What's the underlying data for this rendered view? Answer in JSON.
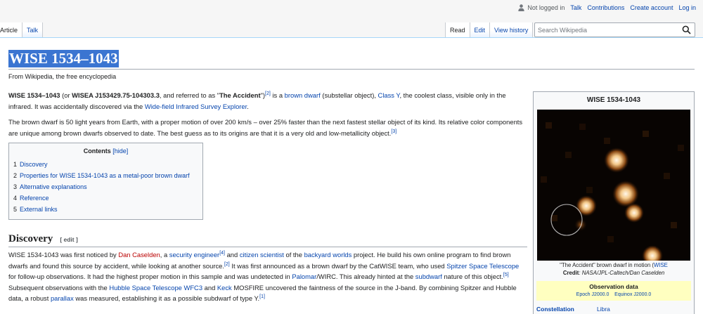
{
  "personal": {
    "not_logged_in": "Not logged in",
    "talk": "Talk",
    "contributions": "Contributions",
    "create_account": "Create account",
    "log_in": "Log in"
  },
  "tabs_left": [
    "Article",
    "Talk"
  ],
  "tabs_right": [
    "Read",
    "Edit",
    "View history"
  ],
  "search": {
    "placeholder": "Search Wikipedia"
  },
  "article": {
    "title": "WISE 1534–1043",
    "site_sub": "From Wikipedia, the free encyclopedia",
    "intro1": {
      "b1": "WISE 1534–1043",
      "t1": " (or ",
      "b2": "WISEA J153429.75-104303.3",
      "t2": ", and referred to as \"",
      "b3": "The Accident",
      "t3": "\")",
      "ref1": "[2]",
      "t4": " is a ",
      "link1": "brown dwarf",
      "t5": " (substellar object), ",
      "link2": "Class Y",
      "t6": ", the coolest class, visible only in the infrared. It was accidentally discovered via the ",
      "link3": "Wide-field Infrared Survey Explorer",
      "t7": "."
    },
    "intro2": {
      "t1": "The brown dwarf is 50 light years from Earth, with a proper motion of over 200 km/s – over 25% faster than the next fastest stellar object of its kind. Its relative color components are unique among brown dwarfs observed to date. The best guess as to its origins are that it is a very old and low-metallicity object.",
      "ref": "[3]"
    },
    "toc": {
      "title": "Contents",
      "hide": "[hide]",
      "items": [
        {
          "num": "1",
          "label": "Discovery"
        },
        {
          "num": "2",
          "label": "Properties for WISE 1534-1043 as a metal-poor brown dwarf"
        },
        {
          "num": "3",
          "label": "Alternative explanations"
        },
        {
          "num": "4",
          "label": "Reference"
        },
        {
          "num": "5",
          "label": "External links"
        }
      ]
    },
    "discovery": {
      "heading": "Discovery",
      "edit": "[ edit ]",
      "t1": "WISE 1534-1043 was first noticed by ",
      "l1": "Dan Caselden",
      "t2": ", a ",
      "l2": "security engineer",
      "r1": "[4]",
      "t3": " and ",
      "l3": "citizen scientist",
      "t4": " of the ",
      "l4": "backyard worlds",
      "t5": " project. He build his own online program to find brown dwarfs and found this source by accident, while looking at another source.",
      "r2": "[2]",
      "t6": " It was first announced as a brown dwarf by the CatWISE team, who used ",
      "l5": "Spitzer Space Telescope",
      "t7": " for follow-up observations. It had the highest proper motion in this sample and was undetected in ",
      "l6": "Palomar",
      "t8": "/WIRC. This already hinted at the ",
      "l7": "subdwarf",
      "t9": " nature of this object.",
      "r3": "[5]",
      "t10": " Subsequent observations with the ",
      "l8": "Hubble Space Telescope",
      "t11": " ",
      "l9": "WFC3",
      "t12": " and ",
      "l10": "Keck",
      "t13": " MOSFIRE uncovered the faintness of the source in the J-band. By combining Spitzer and Hubble data, a robust ",
      "l11": "parallax",
      "t14": " was measured, establishing it as a possible subdwarf of type Y.",
      "r4": "[1]"
    }
  },
  "infobox": {
    "title": "WISE 1534-1043",
    "caption_pre": "\"The Accident\" brown dwarf in motion (",
    "caption_link": "WISE",
    "credit_label": "Credit",
    "credit_text": ": NASA/JPL-Caltech/Dan Caselden",
    "obs_title": "Observation data",
    "epoch": "Epoch J2000.0",
    "equinox": "Equinox J2000.0",
    "constellation_label": "Constellation",
    "constellation_value": "Libra"
  }
}
